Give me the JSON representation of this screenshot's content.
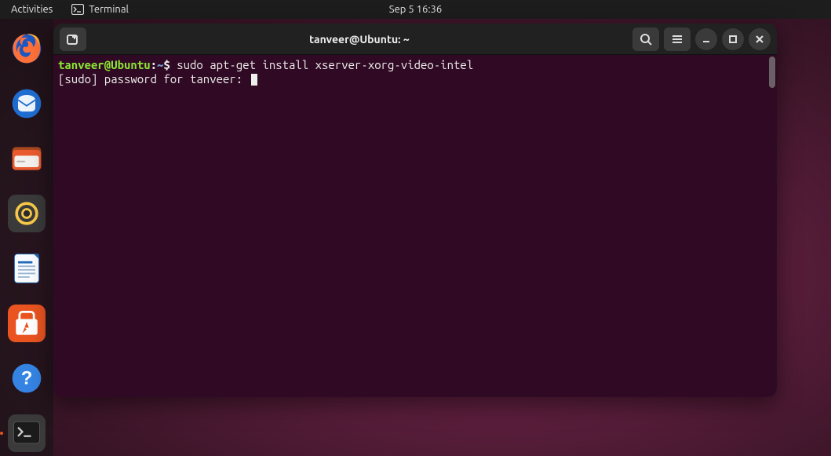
{
  "topbar": {
    "activities": "Activities",
    "app_label": "Terminal",
    "clock": "Sep 5  16:36"
  },
  "dock": {
    "items": [
      {
        "name": "firefox",
        "active": false
      },
      {
        "name": "thunderbird",
        "active": false
      },
      {
        "name": "files",
        "active": false
      },
      {
        "name": "rhythmbox",
        "active": false
      },
      {
        "name": "libreoffice-writer",
        "active": false
      },
      {
        "name": "ubuntu-software",
        "active": false
      },
      {
        "name": "help",
        "active": false
      },
      {
        "name": "terminal",
        "active": true
      }
    ]
  },
  "window": {
    "title": "tanveer@Ubuntu: ~"
  },
  "terminal": {
    "prompt_user": "tanveer@Ubuntu",
    "prompt_colon": ":",
    "prompt_path": "~",
    "prompt_symbol": "$",
    "command": "sudo apt-get install xserver-xorg-video-intel",
    "line2": "[sudo] password for tanveer: "
  }
}
